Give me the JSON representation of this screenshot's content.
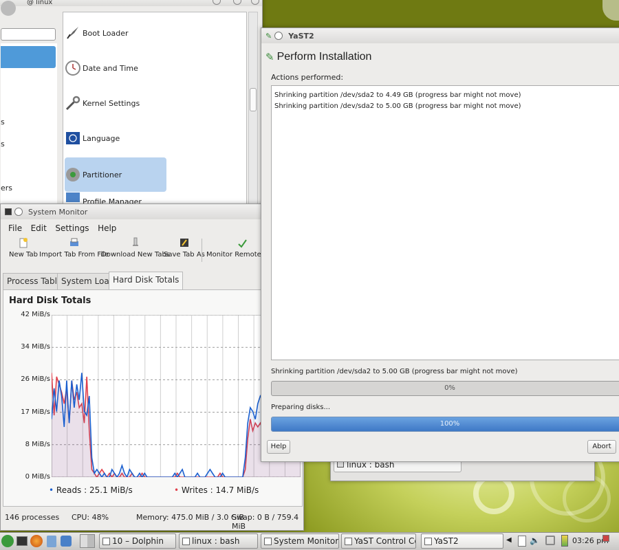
{
  "yast_control_center": {
    "title": "@ linux",
    "modules": [
      {
        "label": "Boot Loader",
        "icon": "rocket-icon"
      },
      {
        "label": "Date and Time",
        "icon": "clock-icon"
      },
      {
        "label": "Kernel Settings",
        "icon": "wrench-icon"
      },
      {
        "label": "Language",
        "icon": "globe-flag-icon"
      },
      {
        "label": "Partitioner",
        "icon": "disk-icon",
        "selected": true
      },
      {
        "label": "Profile Manager",
        "icon": "monitor-icon"
      }
    ],
    "sidebar_fragments": [
      "s",
      "s",
      "ers"
    ]
  },
  "yast2": {
    "title": "YaST2",
    "heading": "Perform Installation",
    "actions_label": "Actions performed:",
    "log_lines": [
      "Shrinking partition /dev/sda2 to 4.49 GB (progress bar might not move)",
      "Shrinking partition /dev/sda2 to 5.00 GB (progress bar might not move)"
    ],
    "step_label": "Shrinking partition /dev/sda2 to 5.00 GB (progress bar might not move)",
    "step_progress_text": "0%",
    "step_progress": 0,
    "overall_label": "Preparing disks...",
    "overall_progress_text": "100%",
    "overall_progress": 100,
    "help_label": "Help",
    "abort_label": "Abort"
  },
  "system_monitor": {
    "title": "System Monitor",
    "menu": [
      "File",
      "Edit",
      "Settings",
      "Help"
    ],
    "toolbar": [
      "New Tab",
      "Import Tab From File",
      "Download New Tabs",
      "Save Tab As",
      "Monitor Remote Mac"
    ],
    "tabs": [
      "Process Table",
      "System Load",
      "Hard Disk Totals"
    ],
    "active_tab": "Hard Disk Totals",
    "graph_title": "Hard Disk Totals",
    "status": {
      "processes": "146 processes",
      "cpu": "CPU: 48%",
      "memory": "Memory: 475.0 MiB / 3.0 GiB",
      "swap": "Swap: 0 B / 759.4 MiB"
    }
  },
  "bg_window": {
    "item": "linux : bash"
  },
  "taskbar": {
    "tasks": [
      "10 – Dolphin",
      "linux : bash",
      "System Monitor",
      "YaST Control Cente",
      "YaST2"
    ],
    "clock": "03:26 pm"
  },
  "colors": {
    "reads": "#1a5fcf",
    "writes": "#e0404c",
    "progress": "#4a86d2",
    "selection": "#b9d3ef",
    "accent": "#4f9ad9"
  },
  "chart_data": {
    "type": "line",
    "title": "Hard Disk Totals",
    "ylabel": "MiB/s",
    "ylim": [
      0,
      42
    ],
    "yticks": [
      "0 MiB/s",
      "8 MiB/s",
      "17 MiB/s",
      "26 MiB/s",
      "34 MiB/s",
      "42 MiB/s"
    ],
    "grid": true,
    "legend_position": "bottom",
    "x": [
      0,
      1,
      2,
      3,
      4,
      5,
      6,
      7,
      8,
      9,
      10,
      11,
      12,
      13,
      14,
      15,
      16,
      17,
      18,
      19,
      20,
      21,
      22,
      23,
      24,
      25,
      26,
      27,
      28,
      29,
      30,
      31,
      32,
      33,
      34,
      35,
      36,
      37,
      38,
      39,
      40,
      41,
      42,
      43,
      44,
      45,
      46,
      47,
      48,
      49,
      50,
      51,
      52,
      53,
      54,
      55,
      56,
      57,
      58,
      59,
      60,
      61,
      62,
      63,
      64,
      65,
      66,
      67,
      68,
      69,
      70,
      71,
      72,
      73,
      74,
      75,
      76,
      77,
      78,
      79,
      80,
      81,
      82,
      83,
      84,
      85,
      86,
      87,
      88,
      89,
      90,
      91,
      92,
      93,
      94,
      95,
      96,
      97,
      98,
      99
    ],
    "series": [
      {
        "name": "Reads",
        "legend": "Reads : 25.1 MiB/s",
        "values": [
          15,
          23,
          17,
          25,
          21,
          13,
          25,
          14,
          25,
          18,
          24,
          20,
          27,
          17,
          16,
          21,
          5,
          1,
          2,
          1,
          0,
          1,
          0,
          0,
          2,
          1,
          0,
          1,
          3,
          1,
          0,
          2,
          1,
          0,
          0,
          1,
          0,
          1,
          0,
          0,
          0,
          0,
          0,
          0,
          0,
          0,
          0,
          0,
          0,
          1,
          0,
          1,
          2,
          0,
          0,
          0,
          0,
          0,
          1,
          0,
          0,
          0,
          1,
          2,
          1,
          0,
          0,
          0,
          1,
          0,
          0,
          0,
          0,
          0,
          0,
          0,
          0,
          5,
          14,
          18,
          17,
          15,
          19,
          21,
          20,
          18,
          16,
          19,
          22,
          21,
          25,
          22,
          24,
          26,
          23,
          24,
          25,
          24,
          25,
          25
        ]
      },
      {
        "name": "Writes",
        "legend": "Writes : 14.7 MiB/s",
        "values": [
          27,
          16,
          26,
          24,
          22,
          19,
          23,
          14,
          25,
          20,
          22,
          18,
          19,
          14,
          26,
          12,
          2,
          1,
          0,
          1,
          2,
          1,
          0,
          1,
          0,
          1,
          0,
          0,
          1,
          0,
          0,
          0,
          1,
          0,
          0,
          0,
          1,
          0,
          0,
          0,
          0,
          0,
          0,
          0,
          0,
          0,
          0,
          0,
          0,
          0,
          1,
          0,
          0,
          0,
          0,
          0,
          0,
          0,
          0,
          0,
          0,
          0,
          0,
          0,
          0,
          0,
          0,
          1,
          0,
          0,
          0,
          0,
          0,
          0,
          0,
          0,
          0,
          2,
          10,
          15,
          12,
          14,
          13,
          14,
          12,
          14,
          15,
          13,
          14,
          15,
          14,
          13,
          15,
          14,
          14,
          15,
          14,
          15,
          14,
          15
        ]
      }
    ]
  }
}
